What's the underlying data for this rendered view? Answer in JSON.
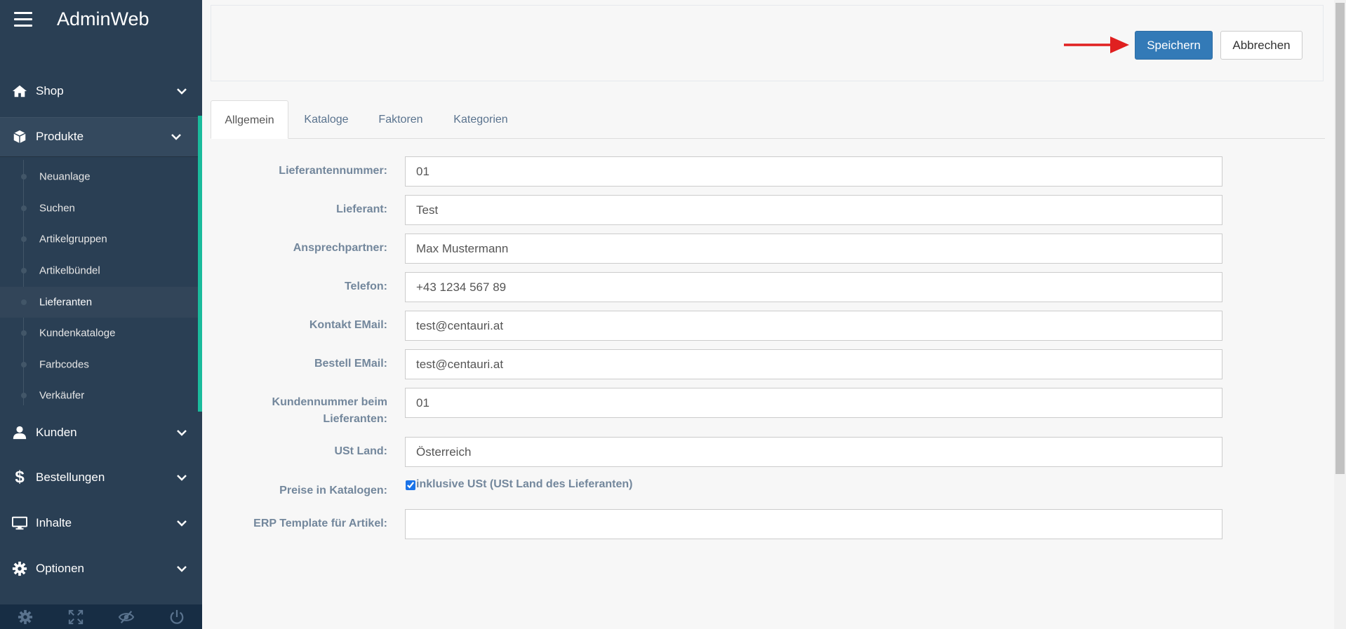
{
  "app": {
    "title": "AdminWeb"
  },
  "sidebar": {
    "nav": {
      "shop": "Shop",
      "produkte": "Produkte",
      "kunden": "Kunden",
      "bestellungen": "Bestellungen",
      "inhalte": "Inhalte",
      "optionen": "Optionen"
    },
    "sub_items": [
      "Neuanlage",
      "Suchen",
      "Artikelgruppen",
      "Artikelbündel",
      "Lieferanten",
      "Kundenkataloge",
      "Farbcodes",
      "Verkäufer"
    ],
    "current_sub": "Lieferanten"
  },
  "toolbar": {
    "save_label": "Speichern",
    "cancel_label": "Abbrechen"
  },
  "tabs": [
    "Allgemein",
    "Kataloge",
    "Faktoren",
    "Kategorien"
  ],
  "active_tab": "Allgemein",
  "form": {
    "lieferantennummer": {
      "label": "Lieferantennummer:",
      "value": "01"
    },
    "lieferant": {
      "label": "Lieferant:",
      "value": "Test"
    },
    "ansprechpartner": {
      "label": "Ansprechpartner:",
      "value": "Max Mustermann"
    },
    "telefon": {
      "label": "Telefon:",
      "value": "+43 1234 567 89"
    },
    "kontakt_email": {
      "label": "Kontakt EMail:",
      "value": "test@centauri.at"
    },
    "bestell_email": {
      "label": "Bestell EMail:",
      "value": "test@centauri.at"
    },
    "kundennummer": {
      "label_line1": "Kundennummer beim",
      "label_line2": "Lieferanten:",
      "value": "01"
    },
    "ust_land": {
      "label": "USt Land:",
      "value": "Österreich"
    },
    "preise": {
      "label": "Preise in Katalogen:",
      "checkbox_label": "inklusive USt (USt Land des Lieferanten)",
      "checked": true
    },
    "erp_template": {
      "label": "ERP Template für Artikel:",
      "value": ""
    }
  },
  "colors": {
    "sidebar_bg": "#2a3f54",
    "accent": "#1abb9c",
    "primary_button": "#337ab7",
    "annotation_arrow": "#e02020"
  }
}
